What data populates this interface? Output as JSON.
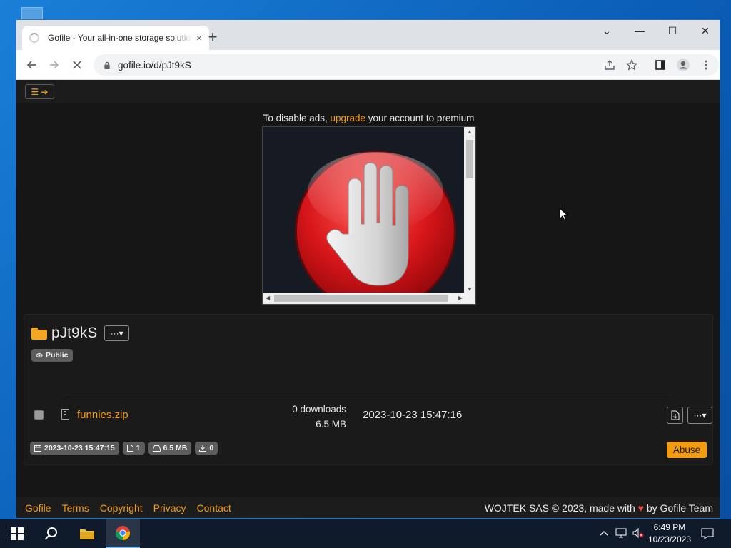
{
  "browser": {
    "tab_title": "Gofile - Your all-in-one storage solution",
    "tab_close": "×",
    "new_tab": "+",
    "url": "gofile.io/d/pJt9kS",
    "window_controls": [
      "⌄",
      "—",
      "☐",
      "✕"
    ]
  },
  "page": {
    "menu_button": "☰ ➔",
    "ad_notice": {
      "prefix": "To disable ads, ",
      "link": "upgrade",
      "suffix": " your account to premium"
    },
    "ad_image": "stop-hand-icon",
    "folder": {
      "name": "pJt9kS",
      "options_button": "···▾",
      "visibility_badge": "Public"
    },
    "file": {
      "name": "funnies.zip",
      "downloads": "0 downloads",
      "size": "6.5 MB",
      "date": "2023-10-23 15:47:16",
      "options_button": "···▾"
    },
    "meta": {
      "created": "2023-10-23 15:47:15",
      "file_count": "1",
      "total_size": "6.5 MB",
      "total_downloads": "0"
    },
    "abuse_button": "Abuse",
    "footer": {
      "links": [
        "Gofile",
        "Terms",
        "Copyright",
        "Privacy",
        "Contact"
      ],
      "credit_prefix": "WOJTEK SAS © 2023, made with",
      "heart": "♥",
      "credit_suffix": "by Gofile Team"
    }
  },
  "taskbar": {
    "time": "6:49 PM",
    "date": "10/23/2023"
  },
  "colors": {
    "accent": "#f39c12",
    "page_bg": "#161616",
    "ad_red": "#d8161a"
  }
}
